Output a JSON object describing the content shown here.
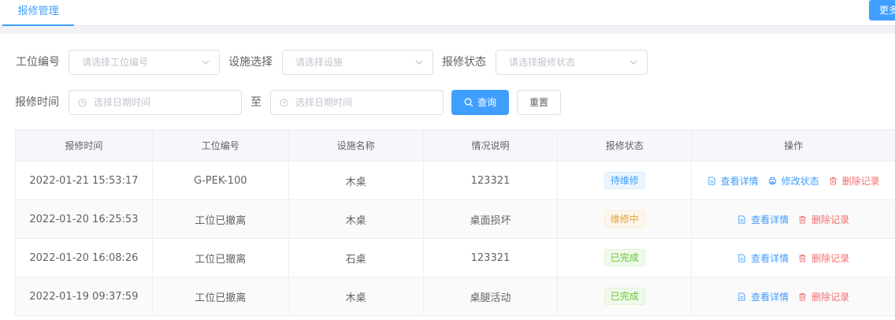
{
  "tabs": {
    "active_label": "报修管理"
  },
  "top_right_button": {
    "label": "更多"
  },
  "filters": {
    "station_label": "工位编号",
    "station_placeholder": "请选择工位编号",
    "facility_label": "设施选择",
    "facility_placeholder": "请选择设施",
    "status_label": "报修状态",
    "status_placeholder": "请选择报修状态",
    "time_label": "报修时间",
    "start_placeholder": "选择日期时间",
    "range_separator": "至",
    "end_placeholder": "选择日期时间",
    "query_label": "查询",
    "reset_label": "重置"
  },
  "table": {
    "columns": [
      "报修时间",
      "工位编号",
      "设施名称",
      "情况说明",
      "报修状态",
      "操作"
    ],
    "rows": [
      {
        "time": "2022-01-21 15:53:17",
        "station": "G-PEK-100",
        "facility": "木桌",
        "desc": "123321",
        "status": "待维修",
        "status_type": "pending",
        "actions": [
          "查看详情",
          "修改状态",
          "删除记录"
        ]
      },
      {
        "time": "2022-01-20 16:25:53",
        "station": "工位已撤离",
        "facility": "木桌",
        "desc": "桌面损坏",
        "status": "维修中",
        "status_type": "repairing",
        "actions": [
          "查看详情",
          "删除记录"
        ]
      },
      {
        "time": "2022-01-20 16:08:26",
        "station": "工位已撤离",
        "facility": "石桌",
        "desc": "123321",
        "status": "已完成",
        "status_type": "done",
        "actions": [
          "查看详情",
          "删除记录"
        ]
      },
      {
        "time": "2022-01-19 09:37:59",
        "station": "工位已撤离",
        "facility": "木桌",
        "desc": "桌腿活动",
        "status": "已完成",
        "status_type": "done",
        "actions": [
          "查看详情",
          "删除记录"
        ]
      }
    ]
  },
  "colors": {
    "primary": "#409eff",
    "danger": "#f56c6c",
    "warning": "#e6a23c",
    "success": "#67c23a"
  }
}
